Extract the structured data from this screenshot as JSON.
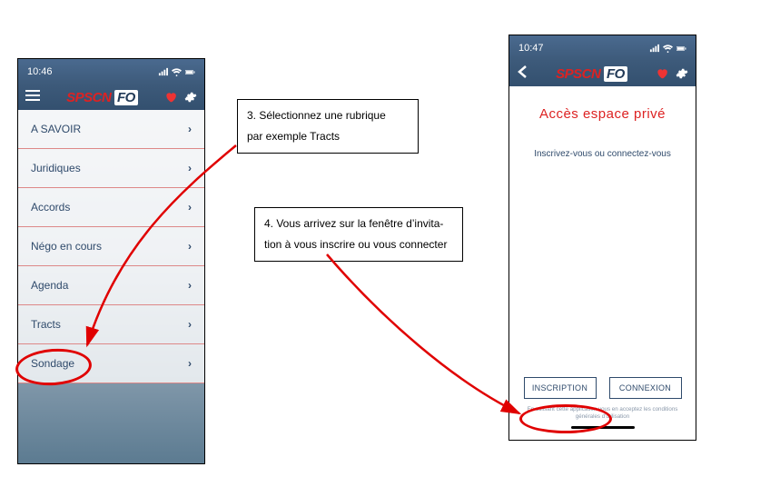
{
  "status": {
    "time": "10:46",
    "time2": "10:47"
  },
  "app": {
    "logo_a": "SPSCN",
    "logo_b": "FO"
  },
  "menu": {
    "items": [
      {
        "label": "A SAVOIR"
      },
      {
        "label": "Juridiques"
      },
      {
        "label": "Accords"
      },
      {
        "label": "Négo en cours"
      },
      {
        "label": "Agenda"
      },
      {
        "label": "Tracts"
      },
      {
        "label": "Sondage"
      }
    ]
  },
  "right": {
    "title": "Accès espace privé",
    "subtitle": "Inscrivez-vous ou connectez-vous",
    "btn_inscription": "INSCRIPTION",
    "btn_connexion": "CONNEXION",
    "terms1": "En utilisant cette application vous en acceptez les conditions",
    "terms2": "générales d'utilisation"
  },
  "callouts": {
    "c3a": "3. Sélectionnez une rubrique",
    "c3b": "par exemple Tracts",
    "c4a": "4. Vous arrivez sur la fenêtre d’invita-",
    "c4b": "tion à vous inscrire ou vous connecter"
  }
}
